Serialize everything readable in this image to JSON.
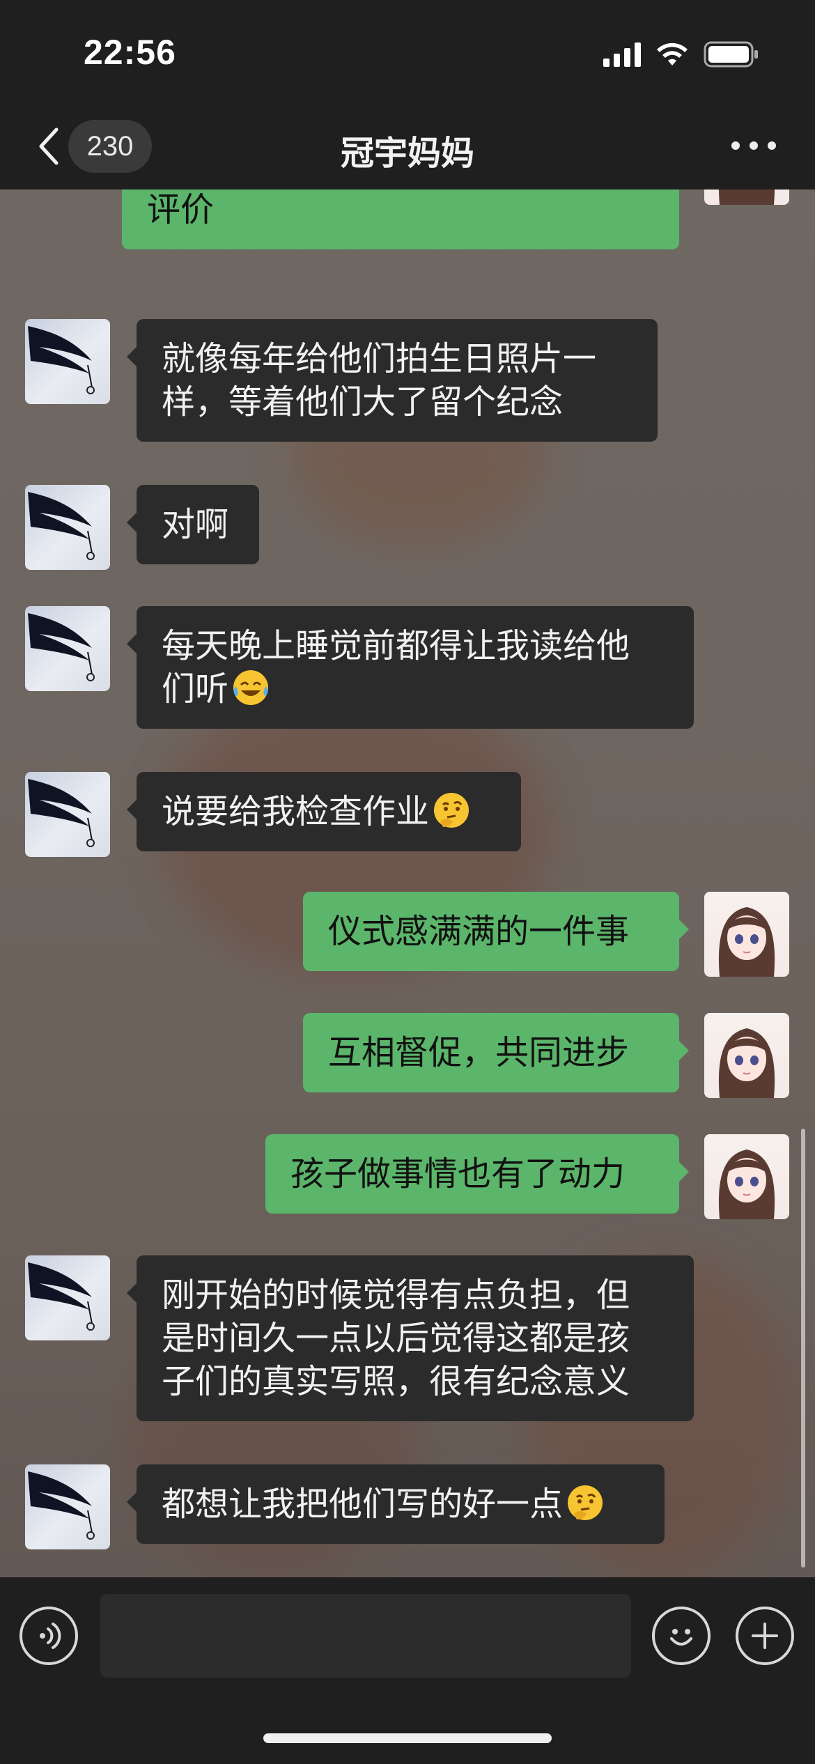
{
  "status_bar": {
    "time": "22:56"
  },
  "nav": {
    "unread_count": "230",
    "title": "冠宇妈妈"
  },
  "messages": [
    {
      "side": "out",
      "avatar": "girl-avatar",
      "text": "孩子们很期待今天妈妈对他们的\n评价"
    },
    {
      "side": "in",
      "avatar": "feather-avatar",
      "text": "就像每年给他们拍生日照片一\n样，等着他们大了留个纪念"
    },
    {
      "side": "in",
      "avatar": "feather-avatar",
      "text": "对啊"
    },
    {
      "side": "in",
      "avatar": "feather-avatar",
      "text": "每天晚上睡觉前都得让我读给他\n们听",
      "emoji": "laughing-crying-emoji"
    },
    {
      "side": "in",
      "avatar": "feather-avatar",
      "text": "说要给我检查作业",
      "emoji": "thinking-emoji"
    },
    {
      "side": "out",
      "avatar": "girl-avatar",
      "text": "仪式感满满的一件事"
    },
    {
      "side": "out",
      "avatar": "girl-avatar",
      "text": "互相督促，共同进步"
    },
    {
      "side": "out",
      "avatar": "girl-avatar",
      "text": "孩子做事情也有了动力"
    },
    {
      "side": "in",
      "avatar": "feather-avatar",
      "text": "刚开始的时候觉得有点负担，但\n是时间久一点以后觉得这都是孩\n子们的真实写照，很有纪念意义"
    },
    {
      "side": "in",
      "avatar": "feather-avatar",
      "text": "都想让我把他们写的好一点",
      "emoji": "thinking-emoji"
    }
  ],
  "input": {
    "value": "",
    "placeholder": ""
  },
  "colors": {
    "bar_bg": "#1f1f1f",
    "incoming_bubble": "#2b2b2b",
    "outgoing_bubble": "#5bb56a"
  }
}
